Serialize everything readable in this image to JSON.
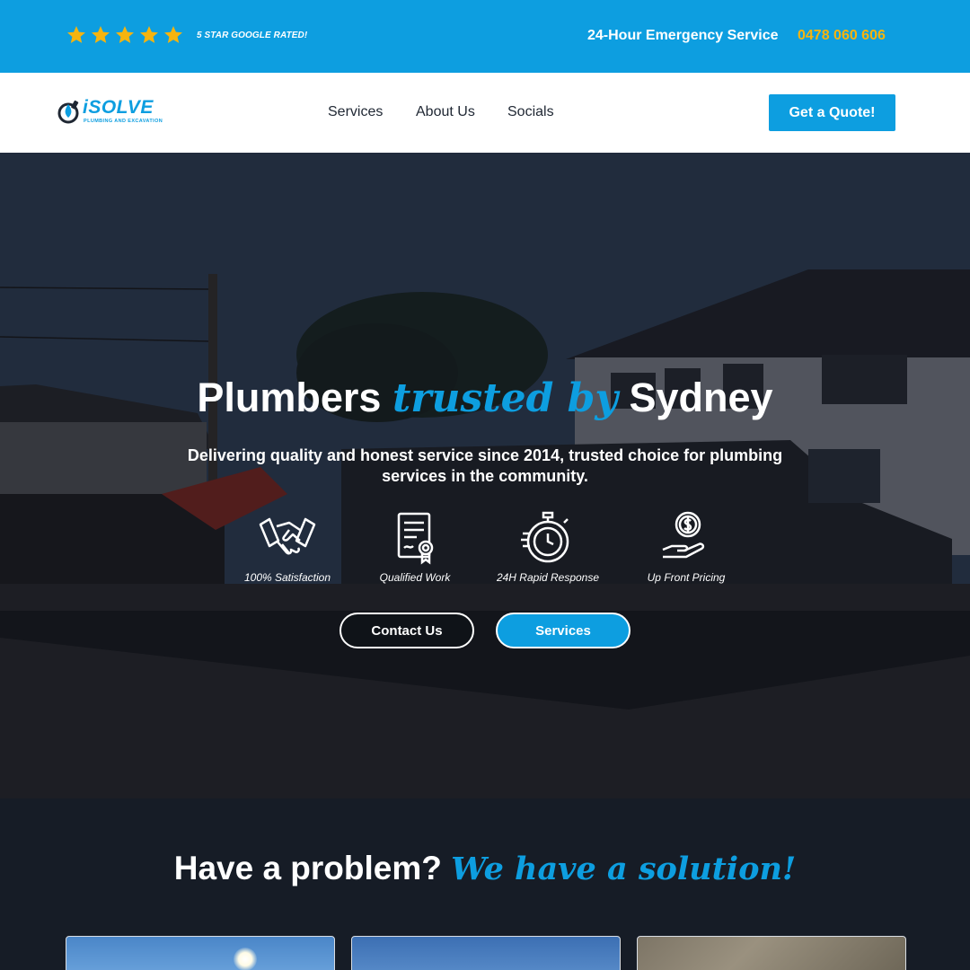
{
  "topbar": {
    "rating_label": "5 STAR GOOGLE RATED!",
    "stars": 5,
    "emergency_text": "24-Hour Emergency Service",
    "phone": "0478 060 606",
    "colors": {
      "background": "#0d9ee0",
      "star": "#f6b40e",
      "phone": "#f6b40e"
    }
  },
  "nav": {
    "logo_word": "iSOLVE",
    "logo_sub": "PLUMBING AND EXCAVATION",
    "links": [
      "Services",
      "About Us",
      "Socials"
    ],
    "cta": "Get a Quote!"
  },
  "hero": {
    "title_start": "Plumbers",
    "title_accent": "trusted by",
    "title_end": "Sydney",
    "subtitle": "Delivering quality and honest service since 2014, trusted choice for plumbing services in the community.",
    "features": [
      {
        "label": "100% Satisfaction",
        "icon": "handshake-icon"
      },
      {
        "label": "Qualified Work",
        "icon": "certificate-icon"
      },
      {
        "label": "24H Rapid Response",
        "icon": "stopwatch-icon"
      },
      {
        "label": "Up Front Pricing",
        "icon": "hand-coin-icon"
      }
    ],
    "buttons": {
      "contact": "Contact Us",
      "services": "Services"
    }
  },
  "problem": {
    "title_start": "Have a problem?",
    "title_accent": "We have a solution!"
  },
  "accent_color": "#0d9ee0"
}
